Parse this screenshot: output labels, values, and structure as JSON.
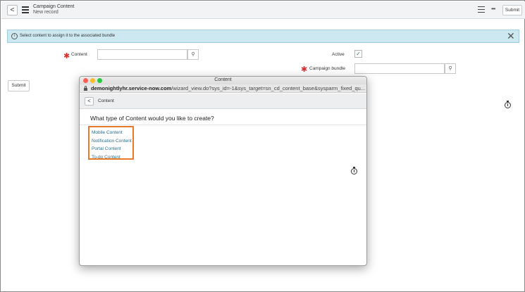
{
  "header": {
    "title": "Campaign Content",
    "subtitle": "New record",
    "more_glyph": "•••",
    "submit_label": "Submit"
  },
  "banner": {
    "message": "Select content to assign it to the associated bundle",
    "icon": "info-icon",
    "close_glyph": "✕"
  },
  "form": {
    "content_label": "Content",
    "content_value": "",
    "active_label": "Active",
    "active_checked": true,
    "campaign_bundle_label": "Campaign bundle",
    "campaign_bundle_value": "",
    "required_mark": "✱",
    "submit_label": "Submit"
  },
  "popup": {
    "window_title": "Content",
    "url_host": "demonightlyhr.service-now.com",
    "url_path": "/wizard_view.do?sys_id=-1&sys_target=sn_cd_content_base&sysparm_fixed_qu...",
    "nav_title": "Content",
    "question": "What type of Content would you like to create?",
    "options": [
      "Mobile Content",
      "Notification Content",
      "Portal Content",
      "To-do Content"
    ]
  },
  "colors": {
    "banner_bg": "#cde8f0",
    "required": "#d6302f",
    "highlight_border": "#e8782a",
    "link": "#2a6e8a",
    "check": "#2e7d4f"
  }
}
